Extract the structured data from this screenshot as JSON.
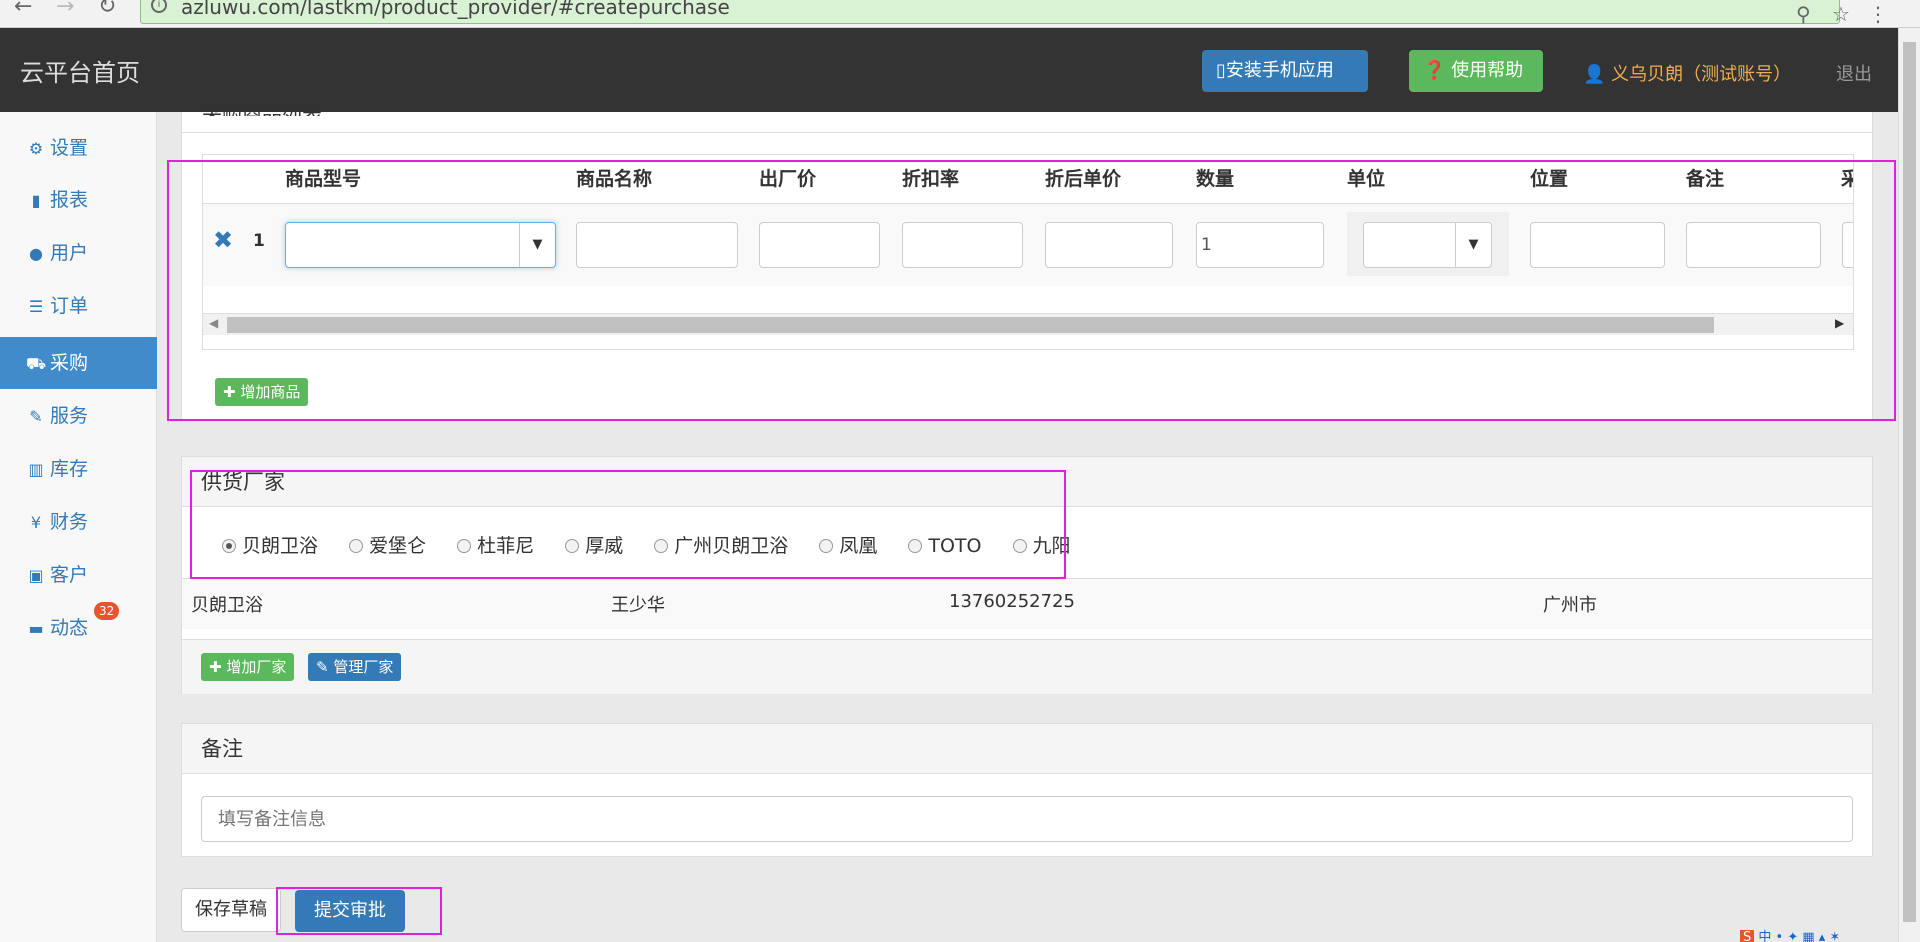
{
  "browser": {
    "url": "azluwu.com/lastkm/product_provider/#createpurchase"
  },
  "header": {
    "brand": "云平台首页",
    "install_app": "安装手机应用",
    "help": "使用帮助",
    "user": "义乌贝朗（测试账号）",
    "logout": "退出"
  },
  "sidebar": {
    "items": [
      {
        "label": "设置",
        "icon": "gear-icon"
      },
      {
        "label": "报表",
        "icon": "bar-chart-icon"
      },
      {
        "label": "用户",
        "icon": "user-icon"
      },
      {
        "label": "订单",
        "icon": "list-icon"
      },
      {
        "label": "采购",
        "icon": "cart-icon"
      },
      {
        "label": "服务",
        "icon": "wrench-icon"
      },
      {
        "label": "库存",
        "icon": "barcode-icon"
      },
      {
        "label": "财务",
        "icon": "yen-icon"
      },
      {
        "label": "客户",
        "icon": "briefcase-icon"
      },
      {
        "label": "动态",
        "icon": "comment-icon"
      }
    ],
    "active": "采购",
    "notification_count": "32"
  },
  "products": {
    "section_title_partial": "采购商品列表",
    "columns": [
      "商品型号",
      "商品名称",
      "出厂价",
      "折扣率",
      "折后单价",
      "数量",
      "单位",
      "位置",
      "备注",
      "采"
    ],
    "row": {
      "index": "1",
      "quantity": "1"
    },
    "add_button": "增加商品"
  },
  "supplier": {
    "title": "供货厂家",
    "options": [
      "贝朗卫浴",
      "爱堡仑",
      "杜菲尼",
      "厚威",
      "广州贝朗卫浴",
      "凤凰",
      "TOTO",
      "九阳"
    ],
    "selected": "贝朗卫浴",
    "info": {
      "name": "贝朗卫浴",
      "contact": "王少华",
      "phone": "13760252725",
      "city": "广州市"
    },
    "add_button": "增加厂家",
    "manage_button": "管理厂家"
  },
  "remarks": {
    "title": "备注",
    "placeholder": "填写备注信息"
  },
  "actions": {
    "save_draft": "保存草稿",
    "submit": "提交审批"
  },
  "colors": {
    "primary": "#337ab7",
    "success": "#5cb85c",
    "warning": "#f0ad4e",
    "header_bg": "#333333",
    "highlight": "#e020e0"
  }
}
